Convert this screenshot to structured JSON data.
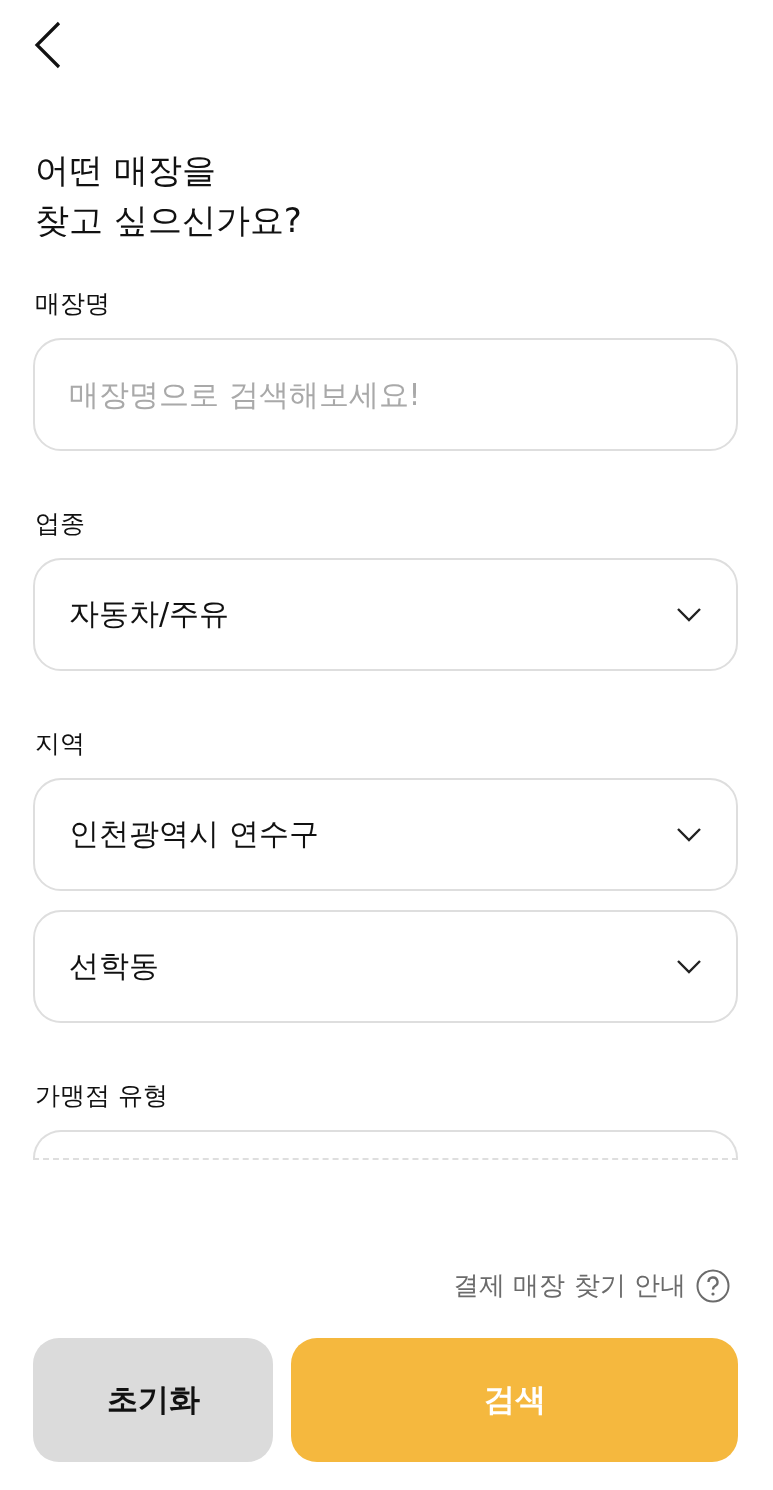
{
  "title": {
    "lines": [
      "어떤 매장을",
      "찾고 싶으신가요?"
    ]
  },
  "sections": [
    {
      "label": "매장명",
      "fields": [
        {
          "kind": "text",
          "placeholder": "매장명으로 검색해보세요!"
        }
      ]
    },
    {
      "label": "업종",
      "fields": [
        {
          "kind": "select",
          "value": "자동차/주유"
        }
      ]
    },
    {
      "label": "지역",
      "fields": [
        {
          "kind": "select",
          "value": "인천광역시 연수구"
        },
        {
          "kind": "select",
          "value": "선학동"
        }
      ]
    },
    {
      "label": "가맹점 유형",
      "fields": [
        {
          "kind": "clipped"
        }
      ]
    }
  ],
  "help_link": "결제 매장 찾기 안내",
  "buttons": [
    {
      "label": "초기화",
      "kind": "secondary"
    },
    {
      "label": "검색",
      "kind": "primary"
    }
  ]
}
